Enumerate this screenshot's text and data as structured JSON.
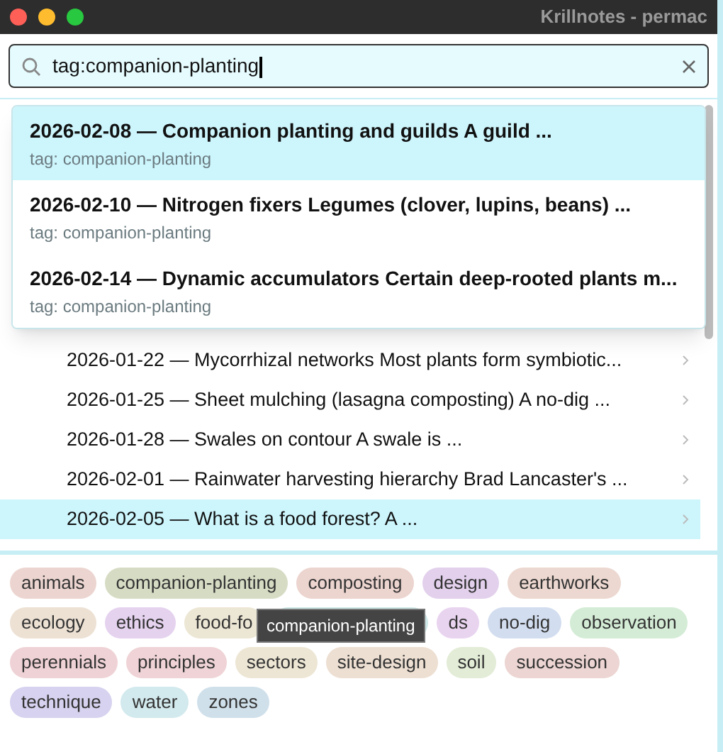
{
  "window": {
    "title": "Krillnotes - permac"
  },
  "search": {
    "value": "tag:companion-planting"
  },
  "results": [
    {
      "title": "2026-02-08 — Companion planting and guilds A guild ...",
      "subtitle": "tag: companion-planting",
      "selected": true
    },
    {
      "title": "2026-02-10 — Nitrogen fixers Legumes (clover, lupins, beans) ...",
      "subtitle": "tag: companion-planting",
      "selected": false
    },
    {
      "title": "2026-02-14 — Dynamic accumulators Certain deep-rooted plants m...",
      "subtitle": "tag: companion-planting",
      "selected": false
    }
  ],
  "tree": {
    "items": [
      {
        "label": "2026-01-22 — Mycorrhizal networks Most plants form symbiotic...",
        "selected": false
      },
      {
        "label": "2026-01-25 — Sheet mulching (lasagna composting) A no-dig ...",
        "selected": false
      },
      {
        "label": "2026-01-28 — Swales on contour A swale is ...",
        "selected": false
      },
      {
        "label": "2026-02-01 — Rainwater harvesting hierarchy Brad Lancaster's ...",
        "selected": false
      },
      {
        "label": "2026-02-05 — What is a food forest? A ...",
        "selected": true
      }
    ]
  },
  "tags": [
    [
      {
        "label": "animals",
        "color": "#ecd5d0"
      },
      {
        "label": "companion-planting",
        "color": "#d6dcc4"
      },
      {
        "label": "composting",
        "color": "#ecd4cf"
      },
      {
        "label": "design",
        "color": "#e2d0ec"
      },
      {
        "label": "earthworks",
        "color": "#ecd8d0"
      }
    ],
    [
      {
        "label": "ecology",
        "color": "#ede1d4"
      },
      {
        "label": "ethics",
        "color": "#e5d2ef"
      },
      {
        "label": "food-fo",
        "color": "#ece6d4"
      },
      {
        "color": "#cde8e6"
      },
      {
        "label": "ds",
        "color": "#e9d4f0"
      },
      {
        "label": "no-dig",
        "color": "#d2ddef"
      },
      {
        "label": "observation",
        "color": "#d4ecd6"
      }
    ],
    [
      {
        "label": "perennials",
        "color": "#efd2d6"
      },
      {
        "label": "principles",
        "color": "#efd3d6"
      },
      {
        "label": "sectors",
        "color": "#ede6d4"
      },
      {
        "label": "site-design",
        "color": "#eddfd2"
      },
      {
        "label": "soil",
        "color": "#e2ecd6"
      },
      {
        "label": "succession",
        "color": "#ecd5d2"
      }
    ],
    [
      {
        "label": "technique",
        "color": "#d6d2ef"
      },
      {
        "label": "water",
        "color": "#d2e9ed"
      },
      {
        "label": "zones",
        "color": "#d0e0ea"
      }
    ]
  ],
  "tooltip": {
    "text": "companion-planting"
  }
}
